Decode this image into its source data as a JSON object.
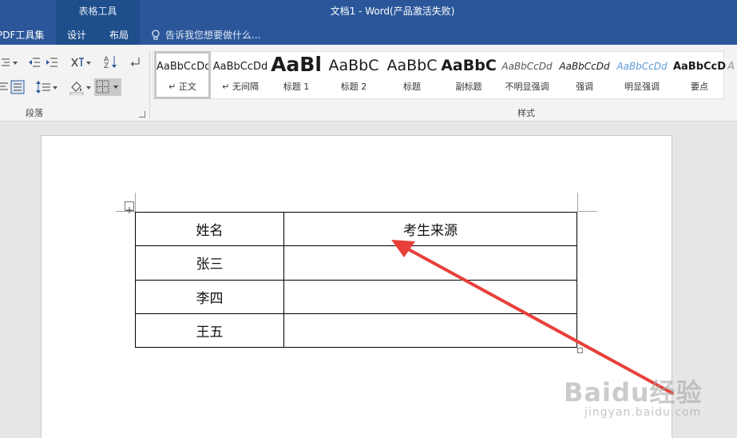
{
  "window": {
    "title": "文档1 - Word(产品激活失败)",
    "context_tool": "表格工具"
  },
  "tabs": [
    {
      "label": "PDF工具集"
    },
    {
      "label": "设计"
    },
    {
      "label": "布局"
    }
  ],
  "tell_me": {
    "text": "告诉我您想要做什么..."
  },
  "ribbon": {
    "groups": {
      "paragraph": "段落",
      "styles": "样式"
    },
    "styles": [
      {
        "sample": "AaBbCcDd",
        "name": "正文",
        "mark": "↵"
      },
      {
        "sample": "AaBbCcDd",
        "name": "无间隔",
        "mark": "↵"
      },
      {
        "sample": "AaBl",
        "name": "标题 1"
      },
      {
        "sample": "AaBbC",
        "name": "标题 2"
      },
      {
        "sample": "AaBbC",
        "name": "标题"
      },
      {
        "sample": "AaBbC",
        "name": "副标题"
      },
      {
        "sample": "AaBbCcDd",
        "name": "不明显强调"
      },
      {
        "sample": "AaBbCcDd",
        "name": "强调"
      },
      {
        "sample": "AaBbCcDd",
        "name": "明显强调"
      },
      {
        "sample": "AaBbCcD",
        "name": "要点"
      },
      {
        "sample": "A",
        "name": ""
      }
    ]
  },
  "table": {
    "rows": [
      [
        "姓名",
        "考生来源"
      ],
      [
        "张三",
        ""
      ],
      [
        "李四",
        ""
      ],
      [
        "王五",
        ""
      ]
    ]
  },
  "watermark": {
    "logo": "Baidu经验",
    "url": "jingyan.baidu.com"
  },
  "colors": {
    "titlebar": "#2b579a",
    "arrow": "#e8403a"
  }
}
